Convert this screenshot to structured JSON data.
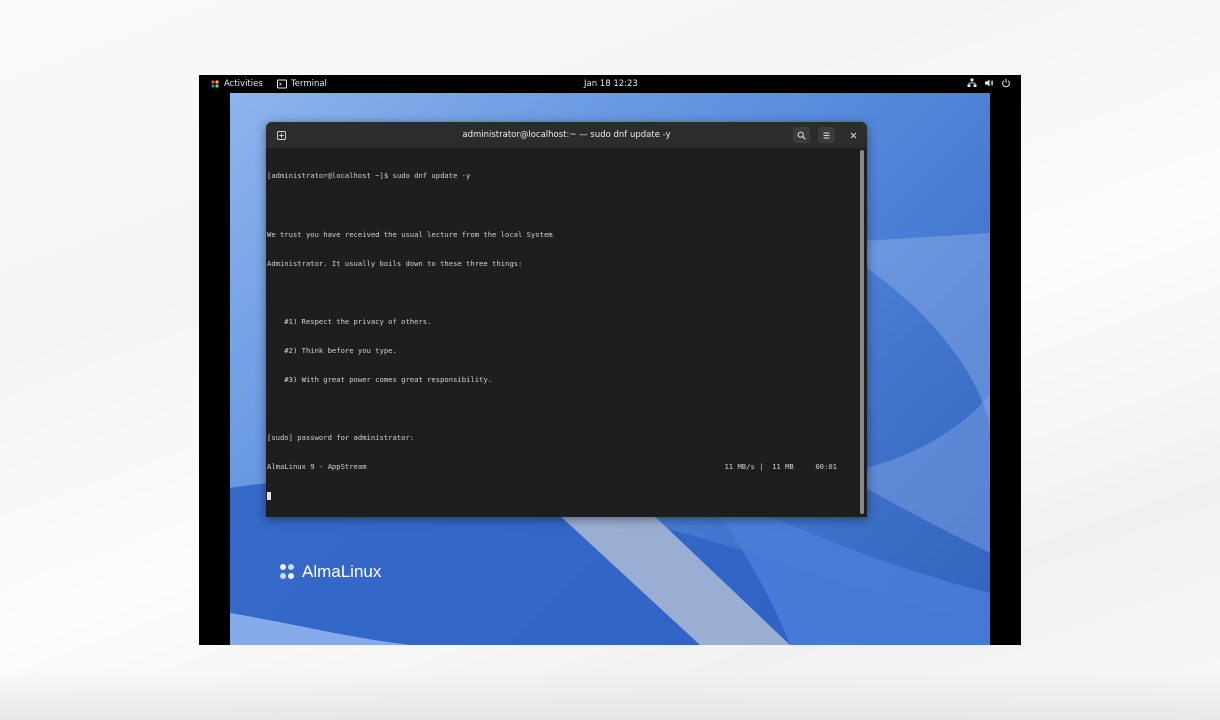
{
  "topbar": {
    "activities_label": "Activities",
    "app_label": "Terminal",
    "clock": "Jan 18  12:23"
  },
  "window": {
    "title": "administrator@localhost:~ — sudo dnf update -y"
  },
  "terminal": {
    "lines": [
      "[administrator@localhost ~]$ sudo dnf update -y",
      "",
      "We trust you have received the usual lecture from the local System",
      "Administrator. It usually boils down to these three things:",
      "",
      "    #1) Respect the privacy of others.",
      "    #2) Think before you type.",
      "    #3) With great power comes great responsibility.",
      "",
      "[sudo] password for administrator:"
    ],
    "progress_line": {
      "left": "AlmaLinux 9 - AppStream",
      "right": "11 MB/s |  11 MB     00:01"
    }
  },
  "desktop": {
    "logo_text": "AlmaLinux"
  },
  "icons": {
    "activities": "almalinux-logo-icon",
    "terminal": "terminal-app-icon",
    "network": "network-icon",
    "volume": "volume-icon",
    "power": "power-icon",
    "new_tab": "new-tab-icon",
    "search": "search-icon",
    "menu": "hamburger-menu-icon",
    "close": "close-icon"
  }
}
